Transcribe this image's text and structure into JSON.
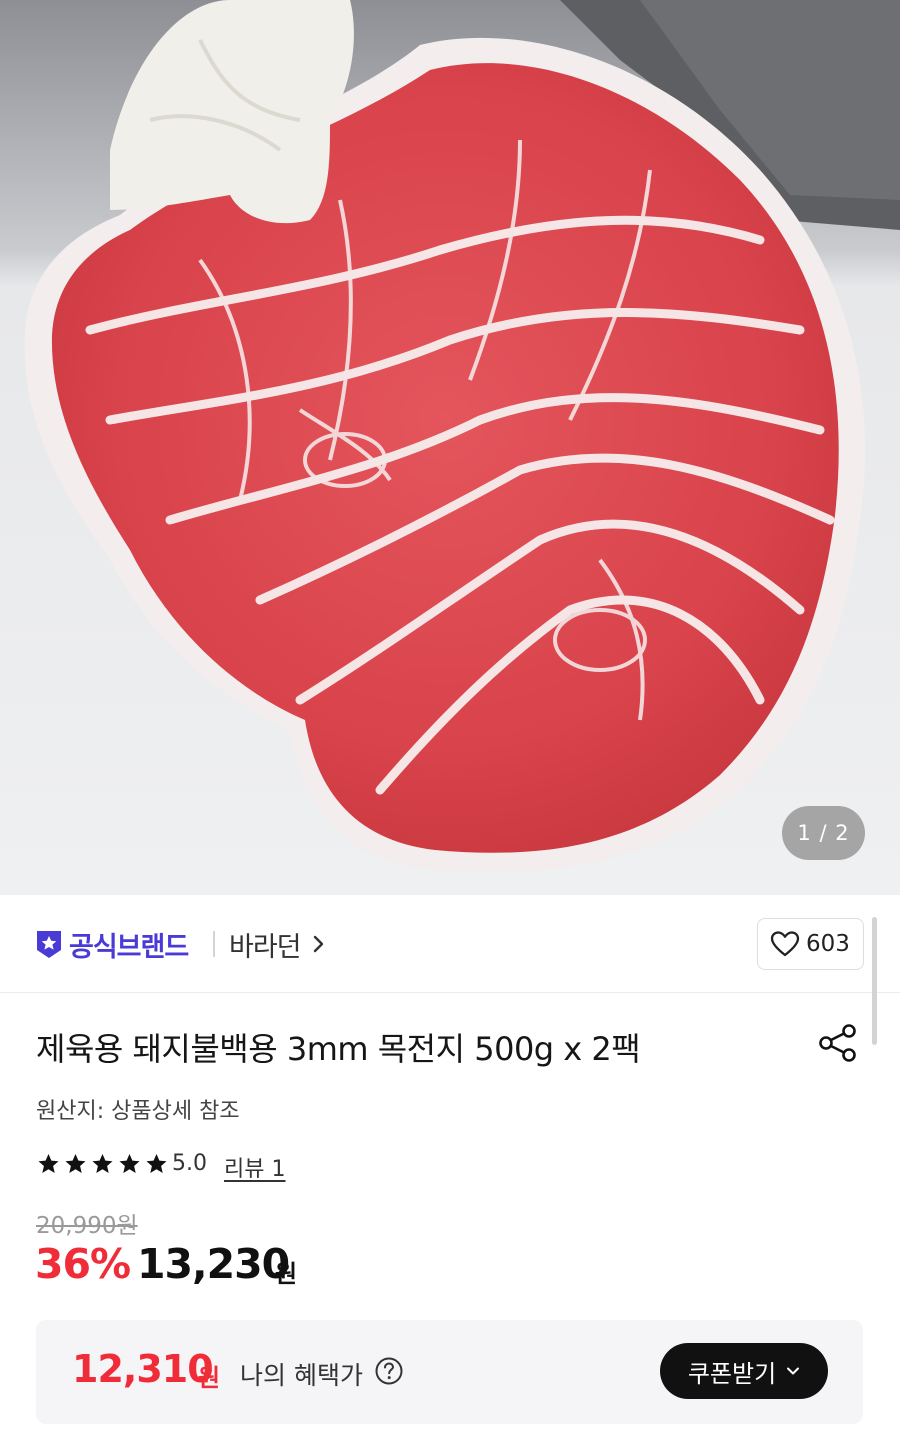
{
  "product_image": {
    "page_indicator": "1 / 2"
  },
  "brand": {
    "official_label": "공식브랜드",
    "name": "바라던",
    "icons": {
      "badge": "official-star-badge-icon",
      "chevron": "chevron-right-icon"
    }
  },
  "like": {
    "count": "603",
    "icon": "heart-outline-icon"
  },
  "product": {
    "title": "제육용 돼지불백용 3mm 목전지 500g x 2팩",
    "origin": "원산지: 상품상세 참조",
    "share_icon": "share-icon"
  },
  "rating": {
    "stars": 5,
    "max_stars": 5,
    "score": "5.0",
    "review_link": "리뷰 1"
  },
  "price": {
    "original": "20,990원",
    "discount_rate": "36%",
    "sale": "13,230",
    "currency": "원"
  },
  "benefit": {
    "price": "12,310",
    "currency": "원",
    "label": "나의 혜택가",
    "help_icon": "question-circle-icon",
    "coupon_button": "쿠폰받기",
    "coupon_icon": "chevron-down-icon"
  },
  "colors": {
    "brand_accent": "#4b3bd6",
    "price_red": "#ef2c38",
    "button_dark": "#111111"
  }
}
